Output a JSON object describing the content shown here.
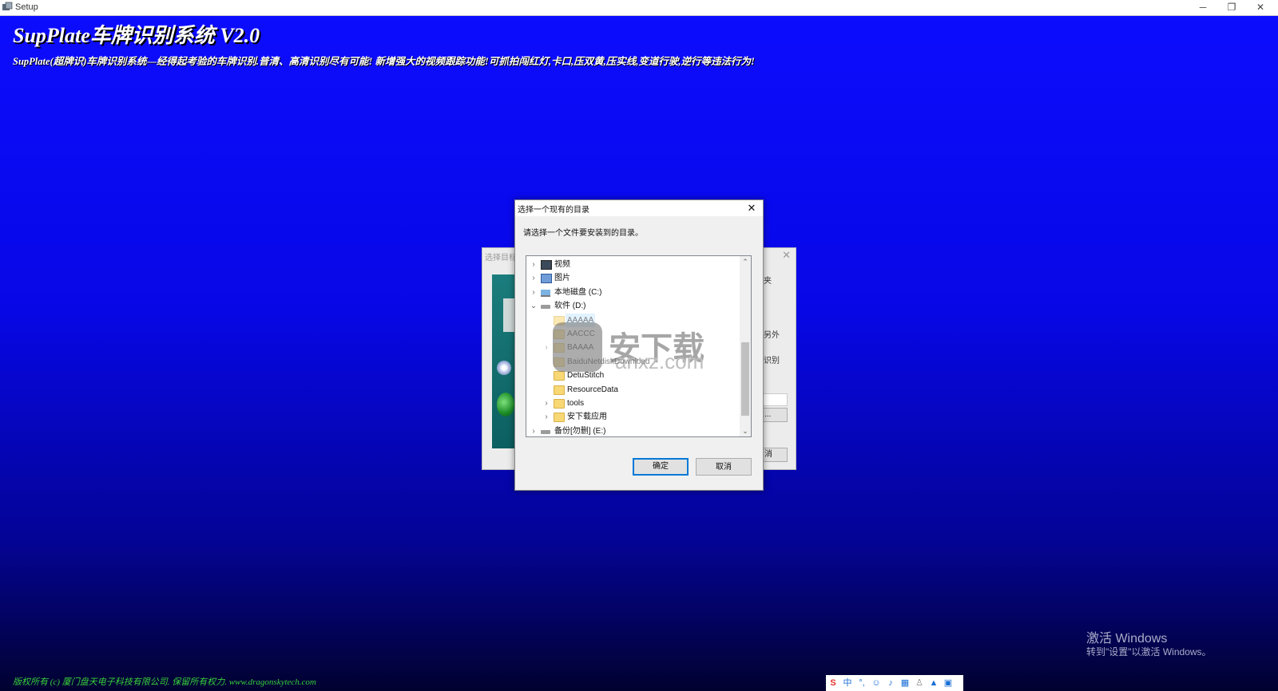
{
  "window": {
    "title": "Setup",
    "controls": {
      "minimize": "─",
      "maximize": "❐",
      "close": "✕"
    }
  },
  "header": {
    "title": "SupPlate车牌识别系统 V2.0",
    "subtitle": "SupPlate(超牌识)车牌识别系统—经得起考验的车牌识别.普清、高清识别尽有可能! 新增强大的视频跟踪功能!可抓拍闯红灯,卡口,压双黄,压实线,变道行驶,逆行等违法行为!"
  },
  "footer": {
    "copyright": "版权所有 (c) 厦门盘天电子科技有限公司. 保留所有权力. www.dragonskytech.com"
  },
  "activation_watermark": {
    "title": "激活 Windows",
    "subtitle": "转到\"设置\"以激活 Windows。"
  },
  "background_wizard": {
    "title": "选择目标",
    "close": "✕",
    "fragments": [
      "夹",
      "另外",
      "识别",
      "...",
      "消"
    ]
  },
  "dialog": {
    "title": "选择一个现有的目录",
    "close": "✕",
    "prompt": "请选择一个文件要安装到的目录。",
    "ok_label": "确定",
    "cancel_label": "取消",
    "tree": [
      {
        "label": "视频",
        "icon": "video-icon",
        "expander": "›",
        "level": 0
      },
      {
        "label": "图片",
        "icon": "picture-icon",
        "expander": "›",
        "level": 0
      },
      {
        "label": "本地磁盘 (C:)",
        "icon": "computer-icon",
        "expander": "›",
        "level": 0
      },
      {
        "label": "软件 (D:)",
        "icon": "drive-icon",
        "expander": "⌄",
        "level": 0
      },
      {
        "label": "AAAAA",
        "icon": "folder-icon",
        "expander": "",
        "level": 1,
        "selected": true
      },
      {
        "label": "AACCC",
        "icon": "folder-icon",
        "expander": "",
        "level": 1
      },
      {
        "label": "BAAAA",
        "icon": "folder-icon",
        "expander": "›",
        "level": 1
      },
      {
        "label": "BaiduNetdiskDownload",
        "icon": "folder-icon",
        "expander": "",
        "level": 1
      },
      {
        "label": "DetuStitch",
        "icon": "folder-icon",
        "expander": "",
        "level": 1
      },
      {
        "label": "ResourceData",
        "icon": "folder-icon",
        "expander": "",
        "level": 1
      },
      {
        "label": "tools",
        "icon": "folder-icon",
        "expander": "›",
        "level": 1
      },
      {
        "label": "安下载应用",
        "icon": "folder-icon",
        "expander": "›",
        "level": 1
      },
      {
        "label": "备份[勿删] (E:)",
        "icon": "drive-icon",
        "expander": "›",
        "level": 0
      }
    ],
    "scroll": {
      "up": "⌃",
      "down": "⌄"
    }
  },
  "download_logo": {
    "text": "安下载",
    "domain": "anxz.com"
  },
  "tray": {
    "ime": "中",
    "icons": [
      "sogou-icon",
      "punctuation-icon",
      "emoji-icon",
      "mic-icon",
      "keyboard-icon",
      "user-icon",
      "shirt-icon",
      "grid-icon"
    ]
  },
  "colors": {
    "background_top": "#0d0dff",
    "background_bottom": "#010130",
    "footer_text": "#38d038",
    "selection": "#cce8ff",
    "primary_border": "#0078d7"
  }
}
